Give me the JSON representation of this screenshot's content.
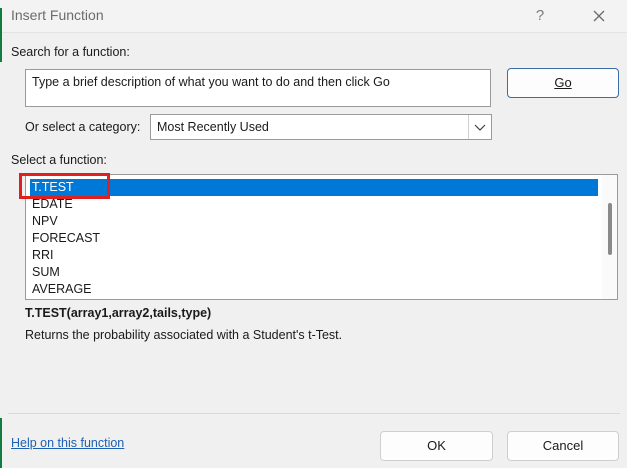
{
  "dialog": {
    "title": "Insert Function",
    "help_glyph": "?"
  },
  "search": {
    "label": "Search for a function:",
    "input_value": "Type a brief description of what you want to do and then click Go",
    "go_label": "Go"
  },
  "category": {
    "label": "Or select a category:",
    "selected": "Most Recently Used"
  },
  "functions": {
    "label": "Select a function:",
    "items": [
      "T.TEST",
      "EDATE",
      "NPV",
      "FORECAST",
      "RRI",
      "SUM",
      "AVERAGE"
    ],
    "selected_index": 0
  },
  "details": {
    "syntax": "T.TEST(array1,array2,tails,type)",
    "description": "Returns the probability associated with a Student's t-Test."
  },
  "footer": {
    "help_link": "Help on this function",
    "ok_label": "OK",
    "cancel_label": "Cancel"
  },
  "colors": {
    "selection": "#0078d7",
    "highlight": "#e0201f",
    "link": "#1f5fb0"
  }
}
